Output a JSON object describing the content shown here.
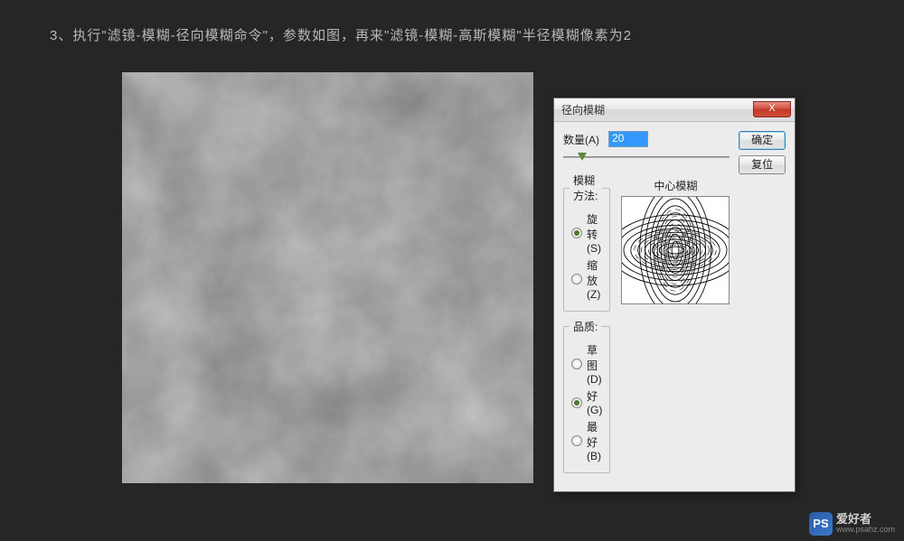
{
  "instruction": "3、执行\"滤镜-模糊-径向模糊命令\"，参数如图，再来\"滤镜-模糊-高斯模糊\"半径模糊像素为2",
  "dialog": {
    "title": "径向模糊",
    "close_glyph": "X",
    "amount_label": "数量(A)",
    "amount_value": "20",
    "ok_label": "确定",
    "reset_label": "复位",
    "method_legend": "模糊方法:",
    "method_options": [
      {
        "label": "旋转(S)",
        "checked": true
      },
      {
        "label": "缩放(Z)",
        "checked": false
      }
    ],
    "quality_legend": "品质:",
    "quality_options": [
      {
        "label": "草图(D)",
        "checked": false
      },
      {
        "label": "好(G)",
        "checked": true
      },
      {
        "label": "最好(B)",
        "checked": false
      }
    ],
    "preview_label": "中心模糊"
  },
  "watermark": {
    "logo": "PS",
    "text": "爱好者",
    "url": "www.psahz.com"
  }
}
